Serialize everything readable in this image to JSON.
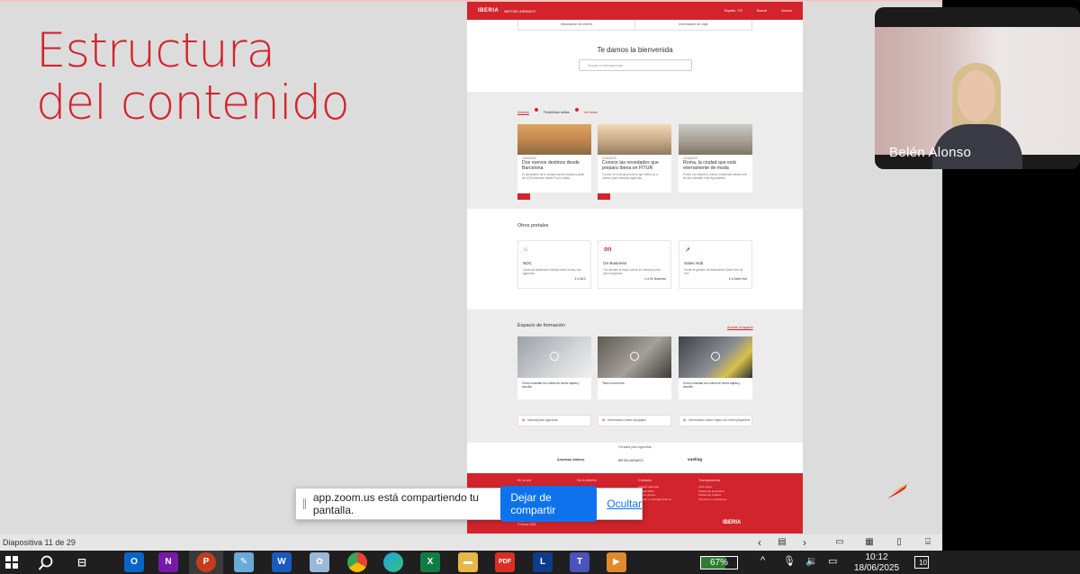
{
  "slide": {
    "title_line1": "Estructura",
    "title_line2": "del contenido"
  },
  "site": {
    "logo": "IBERIA",
    "logo_sub": "AMERICAN",
    "partner_logo": "BRITISH AIRWAYS",
    "nav": [
      "España · ES",
      "Buscar",
      "Acceso"
    ],
    "tabs": [
      "Información de interés",
      "Información de viaje"
    ],
    "welcome": "Te damos la bienvenida",
    "search_placeholder": "Buscar en iberiagencias",
    "news": {
      "tabs": [
        "Noticias",
        "Flexibilidad tarifas",
        "Ver todas"
      ],
      "cards": [
        {
          "date": "13/06/2025",
          "title": "Dos nuevos destinos desde Barcelona",
          "text": "El aeropuerto de la ciudad condal duplica a partir de 2025 sesiones desde Fruji y Malta.",
          "button": "Nuevo"
        },
        {
          "date": "11/06/2025",
          "title": "Conoce las novedades que prepara Iberia en FITUR",
          "text": "Conoce en exclusiva todo lo que Iberia va a ofrecer para nuestras agencias.",
          "button": "FITUR"
        },
        {
          "date": "11/06/2025",
          "title": "Roma, la ciudad que está eternamente de moda",
          "text": "Ponen los mejores y frenos contenidos desde una de las ciudades más importantes.",
          "button": ""
        }
      ]
    },
    "portals": {
      "title": "Otros portales",
      "cards": [
        {
          "icon": "⌂",
          "name": "NDC",
          "text": "Canal de distribución directa entre Iberia y las agencias.",
          "link": "Ir a NDC"
        },
        {
          "icon": "on",
          "name": "On Business",
          "text": "Tus clientes al mejor precio en nuestro portal para empresas.",
          "link": "Ir a On Business"
        },
        {
          "icon": "↗",
          "name": "Sales Hub",
          "text": "Portal de gestión de distribución Sales Hub de IAG.",
          "link": "Ir a Sales Hub"
        }
      ]
    },
    "training": {
      "title": "Espacio de formación",
      "link": "Acceder al espacio",
      "cards": [
        "Cómo consultar tus vuelos de forma rápida y sencilla",
        "Tituto a una línea",
        "Cómo consultar tus vuelos de forma rápida y sencilla"
      ],
      "docs": [
        "Manual para agencias",
        "Información sobre equipajes",
        "Información sobre viajes con niños pequeños"
      ]
    },
    "partners": {
      "title": "Portales para agencias",
      "logos": [
        "American Airlines",
        "BRITISH AIRWAYS",
        "vueling"
      ]
    },
    "footer": {
      "cols": [
        {
          "title": "En la red",
          "items": []
        },
        {
          "title": "De tu interés",
          "items": []
        },
        {
          "title": "Contacto",
          "items": [
            "Contact agencias",
            "Contact NDC",
            "Vuelos grupos",
            "Contact on iberiagencias.es"
          ]
        },
        {
          "title": "Transparencia",
          "items": [
            "Aviso legal",
            "Política de privacidad",
            "Política de cookies",
            "Términos y condiciones"
          ]
        }
      ],
      "copyright": "© Iberia 2025",
      "logo": "IBERIA"
    }
  },
  "video": {
    "participant_name": "Belén Alonso"
  },
  "share_bar": {
    "message": "app.zoom.us está compartiendo tu pantalla.",
    "stop_button": "Dejar de compartir",
    "hide_link": "Ocultar"
  },
  "statusbar": {
    "slide_info": "Diapositiva 11 de 29"
  },
  "taskbar": {
    "battery_percent": "67%",
    "battery_level": 0.67,
    "time": "10:12",
    "date": "18/06/2025",
    "notifications": "10"
  },
  "colors": {
    "iberia_red": "#d3232c",
    "zoom_blue": "#0e72ed"
  }
}
